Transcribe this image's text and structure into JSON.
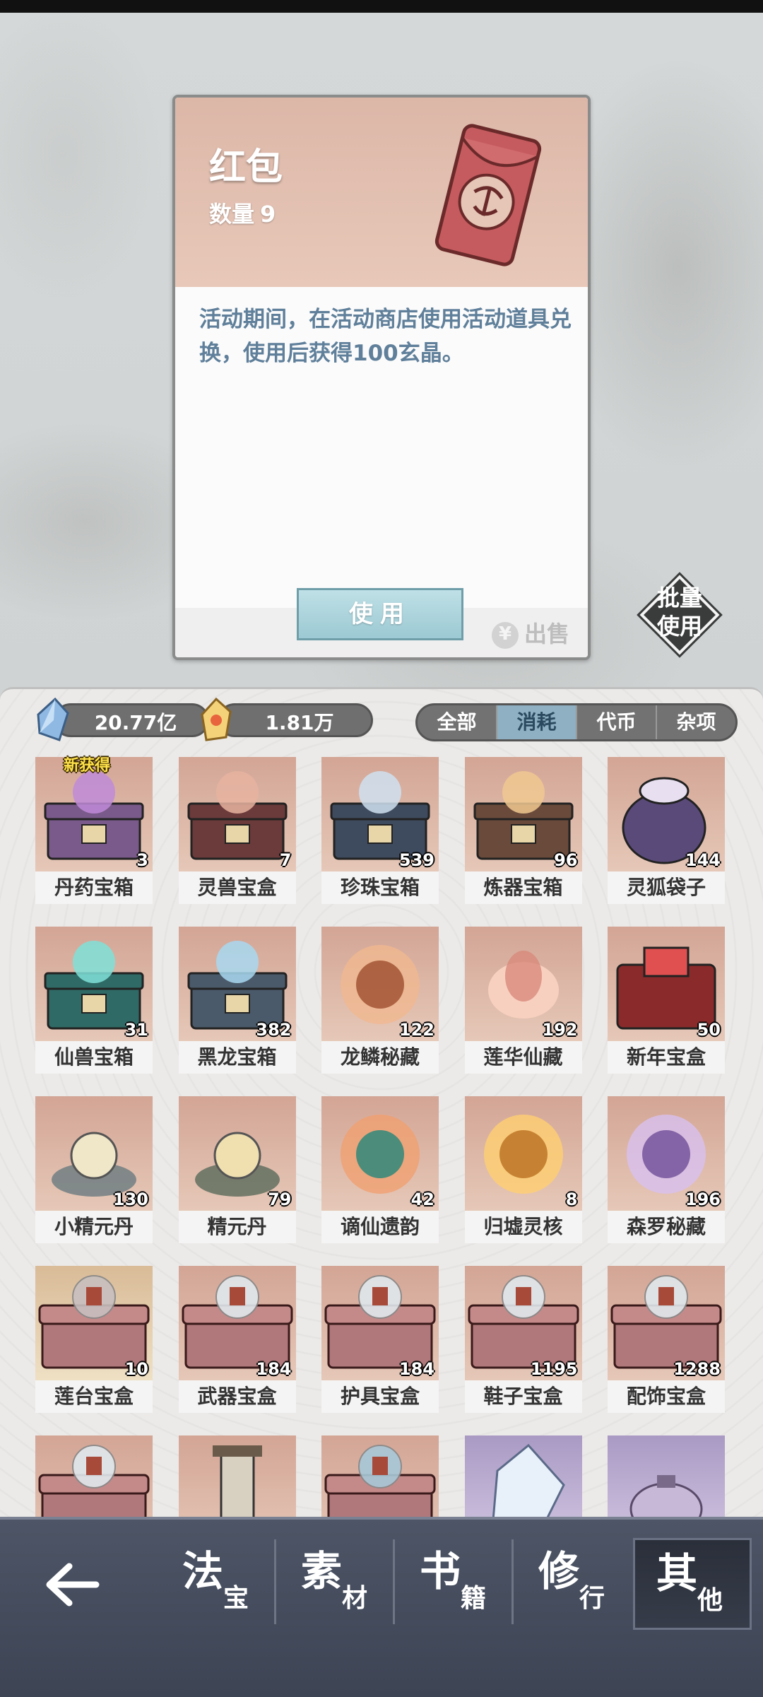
{
  "detail": {
    "title": "红包",
    "count_label": "数量",
    "count": "9",
    "description": "活动期间，在活动商店使用活动道具兑换，使用后获得100玄晶。",
    "use_label": "使用",
    "sell_label": "出售"
  },
  "batch_use": {
    "line1": "批量",
    "line2": "使用"
  },
  "currency": [
    {
      "icon": "blue-crystal-icon",
      "value": "20.77亿"
    },
    {
      "icon": "gold-gem-icon",
      "value": "1.81万"
    }
  ],
  "filters": [
    {
      "label": "全部",
      "active": false
    },
    {
      "label": "消耗",
      "active": true
    },
    {
      "label": "代币",
      "active": false
    },
    {
      "label": "杂项",
      "active": false
    }
  ],
  "items": [
    {
      "name": "丹药宝箱",
      "qty": "3",
      "badge": "新获得"
    },
    {
      "name": "灵兽宝盒",
      "qty": "7"
    },
    {
      "name": "珍珠宝箱",
      "qty": "539"
    },
    {
      "name": "炼器宝箱",
      "qty": "96"
    },
    {
      "name": "灵狐袋子",
      "qty": "144"
    },
    {
      "name": "仙兽宝箱",
      "qty": "31"
    },
    {
      "name": "黑龙宝箱",
      "qty": "382"
    },
    {
      "name": "龙鳞秘藏",
      "qty": "122"
    },
    {
      "name": "莲华仙藏",
      "qty": "192"
    },
    {
      "name": "新年宝盒",
      "qty": "50"
    },
    {
      "name": "小精元丹",
      "qty": "130"
    },
    {
      "name": "精元丹",
      "qty": "79"
    },
    {
      "name": "谪仙遗韵",
      "qty": "42"
    },
    {
      "name": "归墟灵核",
      "qty": "8"
    },
    {
      "name": "森罗秘藏",
      "qty": "196"
    },
    {
      "name": "莲台宝盒",
      "qty": "10"
    },
    {
      "name": "武器宝盒",
      "qty": "184"
    },
    {
      "name": "护具宝盒",
      "qty": "184"
    },
    {
      "name": "鞋子宝盒",
      "qty": "1195"
    },
    {
      "name": "配饰宝盒",
      "qty": "1288"
    },
    {
      "name": "",
      "qty": ""
    },
    {
      "name": "",
      "qty": ""
    },
    {
      "name": "",
      "qty": ""
    },
    {
      "name": "",
      "qty": ""
    },
    {
      "name": "",
      "qty": ""
    }
  ],
  "nav": {
    "back_icon": "back-arrow-icon",
    "tabs": [
      {
        "big": "法",
        "small": "宝",
        "active": false
      },
      {
        "big": "素",
        "small": "材",
        "active": false
      },
      {
        "big": "书",
        "small": "籍",
        "active": false
      },
      {
        "big": "修",
        "small": "行",
        "active": false
      },
      {
        "big": "其",
        "small": "他",
        "active": true
      }
    ]
  }
}
